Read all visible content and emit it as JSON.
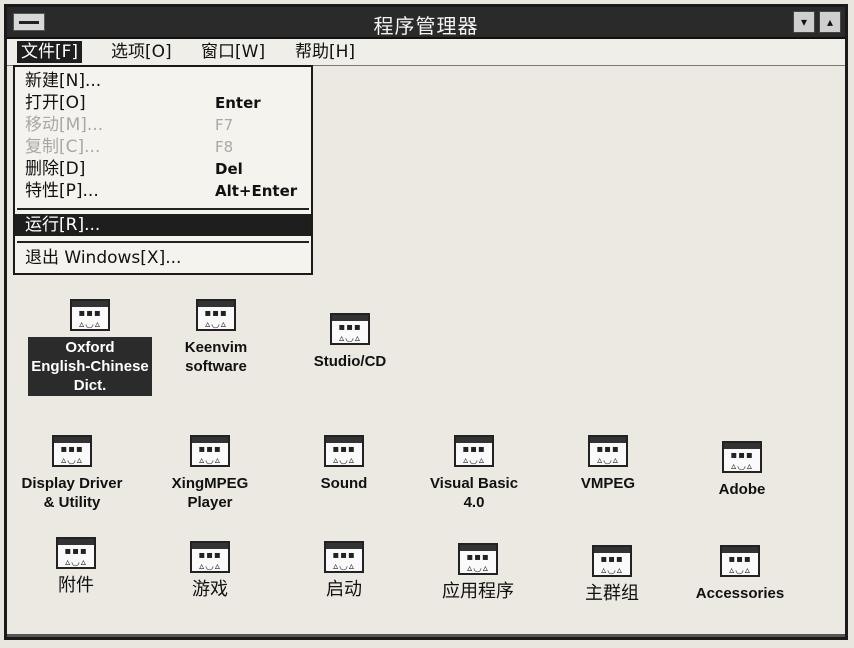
{
  "window": {
    "title": "程序管理器",
    "minimize_glyph": "▾",
    "maximize_glyph": "▴"
  },
  "menubar": [
    {
      "label": "文件[F]"
    },
    {
      "label": "选项[O]"
    },
    {
      "label": "窗口[W]"
    },
    {
      "label": "帮助[H]"
    }
  ],
  "file_menu": [
    {
      "label": "新建[N]...",
      "key": ""
    },
    {
      "label": "打开[O]",
      "key": "Enter"
    },
    {
      "label": "移动[M]...",
      "key": "F7"
    },
    {
      "label": "复制[C]...",
      "key": "F8"
    },
    {
      "label": "删除[D]",
      "key": "Del"
    },
    {
      "label": "特性[P]...",
      "key": "Alt+Enter"
    },
    {
      "label": "运行[R]...",
      "key": ""
    },
    {
      "label": "退出 Windows[X]...",
      "key": ""
    }
  ],
  "icon_glyphs": "▪▪▪\n▵◡▵",
  "groups": [
    {
      "label": "Oxford\nEnglish-Chinese\nDict."
    },
    {
      "label": "Keenvim\nsoftware"
    },
    {
      "label": "Studio/CD"
    },
    {
      "label": "Display Driver\n& Utility"
    },
    {
      "label": "XingMPEG\nPlayer"
    },
    {
      "label": "Sound"
    },
    {
      "label": "Visual Basic\n4.0"
    },
    {
      "label": "VMPEG"
    },
    {
      "label": "Adobe"
    },
    {
      "label": "附件"
    },
    {
      "label": "游戏"
    },
    {
      "label": "启动"
    },
    {
      "label": "应用程序"
    },
    {
      "label": "主群组"
    },
    {
      "label": "Accessories"
    }
  ]
}
